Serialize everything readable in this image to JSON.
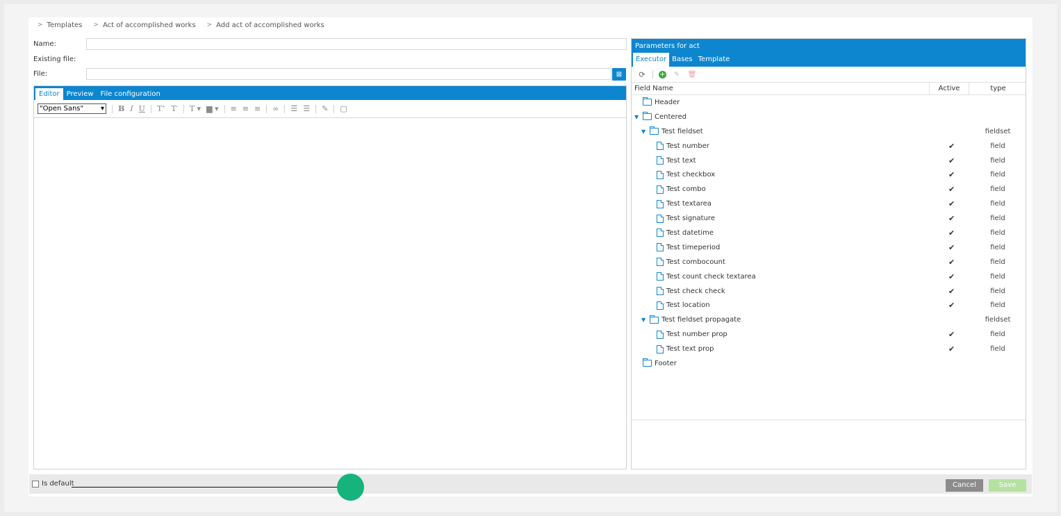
{
  "breadcrumb": [
    "Templates",
    "Act of accomplished works",
    "Add act of accomplished works"
  ],
  "form": {
    "name_label": "Name:",
    "name_value": "",
    "existing_file_label": "Existing file:",
    "file_label": "File:",
    "file_value": ""
  },
  "editor": {
    "tabs": [
      "Editor",
      "Preview",
      "File configuration"
    ],
    "font_value": "\"Open Sans\""
  },
  "params": {
    "title": "Parameters for act",
    "tabs": [
      "Executor",
      "Bases",
      "Template"
    ],
    "columns": [
      "Field Name",
      "Active",
      "type"
    ],
    "rows": [
      {
        "name": "Header",
        "kind": "folder",
        "level": 0,
        "expanded": false,
        "active": "",
        "type": ""
      },
      {
        "name": "Centered",
        "kind": "folder",
        "level": 0,
        "expanded": true,
        "active": "",
        "type": ""
      },
      {
        "name": "Test fieldset",
        "kind": "folder",
        "level": 1,
        "expanded": true,
        "active": "",
        "type": "fieldset"
      },
      {
        "name": "Test number",
        "kind": "file",
        "level": 2,
        "active": "✔",
        "type": "field"
      },
      {
        "name": "Test text",
        "kind": "file",
        "level": 2,
        "active": "✔",
        "type": "field"
      },
      {
        "name": "Test checkbox",
        "kind": "file",
        "level": 2,
        "active": "✔",
        "type": "field"
      },
      {
        "name": "Test combo",
        "kind": "file",
        "level": 2,
        "active": "✔",
        "type": "field"
      },
      {
        "name": "Test textarea",
        "kind": "file",
        "level": 2,
        "active": "✔",
        "type": "field"
      },
      {
        "name": "Test signature",
        "kind": "file",
        "level": 2,
        "active": "✔",
        "type": "field"
      },
      {
        "name": "Test datetime",
        "kind": "file",
        "level": 2,
        "active": "✔",
        "type": "field"
      },
      {
        "name": "Test timeperiod",
        "kind": "file",
        "level": 2,
        "active": "✔",
        "type": "field"
      },
      {
        "name": "Test combocount",
        "kind": "file",
        "level": 2,
        "active": "✔",
        "type": "field"
      },
      {
        "name": "Test count check textarea",
        "kind": "file",
        "level": 2,
        "active": "✔",
        "type": "field"
      },
      {
        "name": "Test check check",
        "kind": "file",
        "level": 2,
        "active": "✔",
        "type": "field"
      },
      {
        "name": "Test location",
        "kind": "file",
        "level": 2,
        "active": "✔",
        "type": "field"
      },
      {
        "name": "Test fieldset propagate",
        "kind": "folder",
        "level": 1,
        "expanded": true,
        "active": "",
        "type": "fieldset"
      },
      {
        "name": "Test number prop",
        "kind": "file",
        "level": 2,
        "active": "✔",
        "type": "field"
      },
      {
        "name": "Test text prop",
        "kind": "file",
        "level": 2,
        "active": "✔",
        "type": "field"
      },
      {
        "name": "Footer",
        "kind": "folder",
        "level": 0,
        "expanded": false,
        "active": "",
        "type": ""
      }
    ]
  },
  "footer": {
    "is_default_label": "Is default",
    "cancel_label": "Cancel",
    "save_label": "Save"
  },
  "colors": {
    "accent": "#0d86cf",
    "save": "#b6e2a1",
    "cancel": "#8c8c8c"
  }
}
